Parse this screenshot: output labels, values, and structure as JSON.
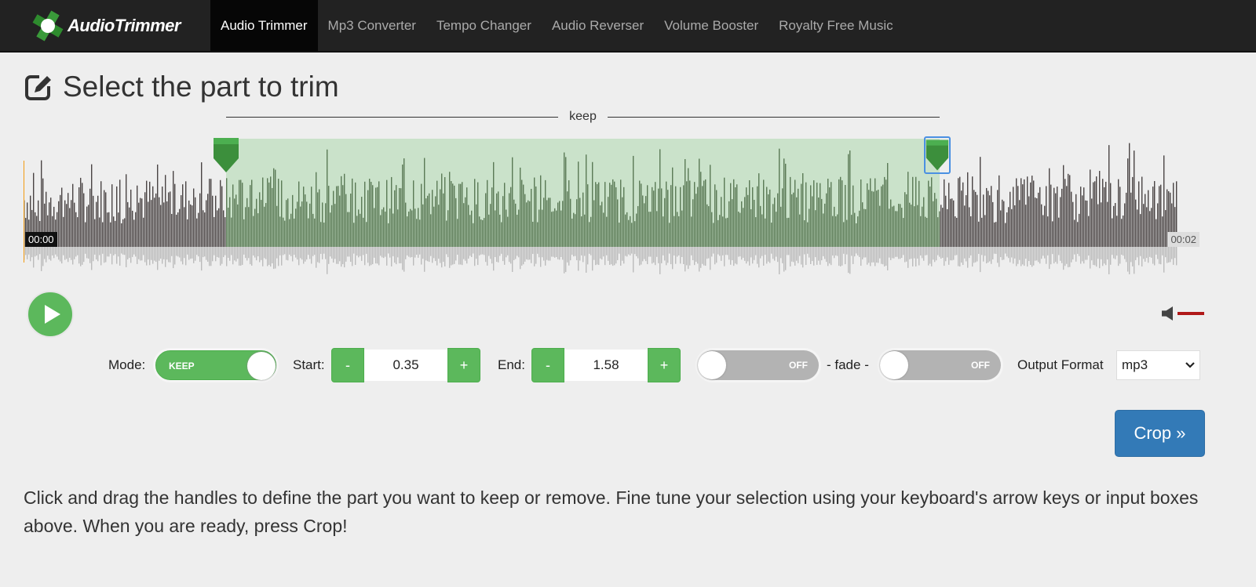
{
  "nav": {
    "logo": "AudioTrimmer",
    "items": [
      {
        "label": "Audio Trimmer",
        "active": true
      },
      {
        "label": "Mp3 Converter"
      },
      {
        "label": "Tempo Changer"
      },
      {
        "label": "Audio Reverser"
      },
      {
        "label": "Volume Booster"
      },
      {
        "label": "Royalty Free Music"
      }
    ]
  },
  "page": {
    "title": "Select the part to trim"
  },
  "waveform": {
    "region_label": "keep",
    "time_start": "00:00",
    "time_end": "00:02",
    "selection_color": "#c8e6c8",
    "wave_color": "#4a4444"
  },
  "controls": {
    "mode_label": "Mode:",
    "mode_value": "KEEP",
    "start_label": "Start:",
    "start_value": "0.35",
    "end_label": "End:",
    "end_value": "1.58",
    "minus": "-",
    "plus": "+",
    "fade_in": "OFF",
    "fade_label": "- fade -",
    "fade_out": "OFF",
    "format_label": "Output Format",
    "format_value": "mp3"
  },
  "crop_button": "Crop »",
  "help_text": "Click and drag the handles to define the part you want to keep or remove. Fine tune your selection using your keyboard's arrow keys or input boxes above. When you are ready, press Crop!",
  "colors": {
    "accent": "#5cb85c",
    "primary": "#337ab7",
    "nav_bg": "#222222"
  }
}
